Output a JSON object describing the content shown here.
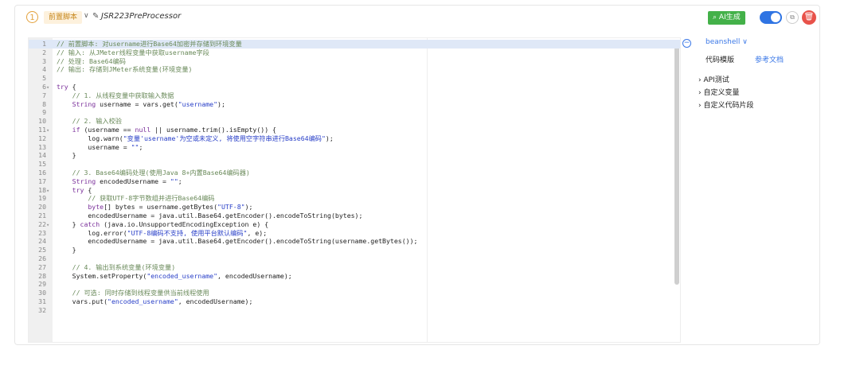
{
  "header": {
    "step_number": "1",
    "tag": "前置脚本",
    "script_name": "JSR223PreProcessor",
    "ai_button": "AI生成"
  },
  "side": {
    "language": "beanshell",
    "template_tab": "代码模版",
    "docs_tab": "参考文档",
    "tree": [
      "API测试",
      "自定义变量",
      "自定义代码片段"
    ]
  },
  "code_lines": [
    {
      "n": "1",
      "f": "",
      "t": "// 前置脚本: 对username进行Base64加密并存储到环境变量"
    },
    {
      "n": "2",
      "f": "",
      "t": "// 输入: 从JMeter线程变量中获取username字段"
    },
    {
      "n": "3",
      "f": "",
      "t": "// 处理: Base64编码"
    },
    {
      "n": "4",
      "f": "",
      "t": "// 输出: 存储到JMeter系统变量(环境变量)"
    },
    {
      "n": "5",
      "f": "",
      "t": ""
    },
    {
      "n": "6",
      "f": "▾",
      "t": "try {"
    },
    {
      "n": "7",
      "f": "",
      "t": "    // 1. 从线程变量中获取输入数据"
    },
    {
      "n": "8",
      "f": "",
      "t": "    String username = vars.get(\"username\");"
    },
    {
      "n": "9",
      "f": "",
      "t": ""
    },
    {
      "n": "10",
      "f": "",
      "t": "    // 2. 输入校验"
    },
    {
      "n": "11",
      "f": "▾",
      "t": "    if (username == null || username.trim().isEmpty()) {"
    },
    {
      "n": "12",
      "f": "",
      "t": "        log.warn(\"变量'username'为空或未定义, 将使用空字符串进行Base64编码\");"
    },
    {
      "n": "13",
      "f": "",
      "t": "        username = \"\";"
    },
    {
      "n": "14",
      "f": "",
      "t": "    }"
    },
    {
      "n": "15",
      "f": "",
      "t": ""
    },
    {
      "n": "16",
      "f": "",
      "t": "    // 3. Base64编码处理(使用Java 8+内置Base64编码器)"
    },
    {
      "n": "17",
      "f": "",
      "t": "    String encodedUsername = \"\";"
    },
    {
      "n": "18",
      "f": "▾",
      "t": "    try {"
    },
    {
      "n": "19",
      "f": "",
      "t": "        // 获取UTF-8字节数组并进行Base64编码"
    },
    {
      "n": "20",
      "f": "",
      "t": "        byte[] bytes = username.getBytes(\"UTF-8\");"
    },
    {
      "n": "21",
      "f": "",
      "t": "        encodedUsername = java.util.Base64.getEncoder().encodeToString(bytes);"
    },
    {
      "n": "22",
      "f": "▾",
      "t": "    } catch (java.io.UnsupportedEncodingException e) {"
    },
    {
      "n": "23",
      "f": "",
      "t": "        log.error(\"UTF-8编码不支持, 使用平台默认编码\", e);"
    },
    {
      "n": "24",
      "f": "",
      "t": "        encodedUsername = java.util.Base64.getEncoder().encodeToString(username.getBytes());"
    },
    {
      "n": "25",
      "f": "",
      "t": "    }"
    },
    {
      "n": "26",
      "f": "",
      "t": ""
    },
    {
      "n": "27",
      "f": "",
      "t": "    // 4. 输出到系统变量(环境变量)"
    },
    {
      "n": "28",
      "f": "",
      "t": "    System.setProperty(\"encoded_username\", encodedUsername);"
    },
    {
      "n": "29",
      "f": "",
      "t": ""
    },
    {
      "n": "30",
      "f": "",
      "t": "    // 可选: 同时存储到线程变量供当前线程使用"
    },
    {
      "n": "31",
      "f": "",
      "t": "    vars.put(\"encoded_username\", encodedUsername);"
    },
    {
      "n": "32",
      "f": "",
      "t": ""
    }
  ],
  "colors": {
    "comment": "#6a8a5a",
    "string": "#2a40c8",
    "keyword": "#7a2f9a",
    "accent": "#3b78e7",
    "ai": "#43b149",
    "delete": "#e8524a"
  }
}
